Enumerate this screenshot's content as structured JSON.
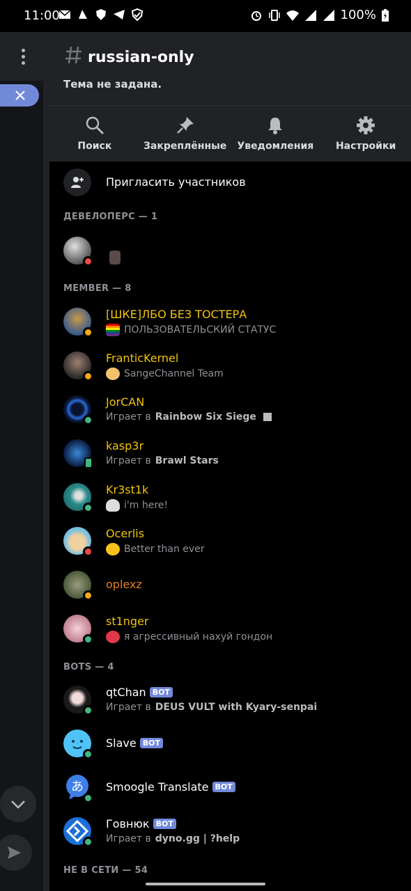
{
  "status_bar": {
    "time": "11:00",
    "battery": "100%"
  },
  "channel": {
    "name": "russian-only",
    "topic": "Тема не задана."
  },
  "actions": [
    {
      "label": "Поиск",
      "icon": "search-icon"
    },
    {
      "label": "Закреплённые",
      "icon": "pin-icon"
    },
    {
      "label": "Уведомления",
      "icon": "bell-icon"
    },
    {
      "label": "Настройки",
      "icon": "gear-icon"
    }
  ],
  "invite_label": "Пригласить участников",
  "sections": {
    "developers": "ДЕВЕЛОПЕРС — 1",
    "member": "MEMBER — 8",
    "bots": "BOTS — 4",
    "offline": "НЕ В СЕТИ — 54"
  },
  "bot_tag": "BOT",
  "members": [
    {
      "name": "[ШКЕ]ЛБО БЕЗ ТОСТЕРА",
      "status": "ПОЛЬЗОВАТЕЛЬСКИЙ СТАТУС"
    },
    {
      "name": "FranticKernel",
      "status": "SangeChannel Team"
    },
    {
      "name": "JorCAN",
      "activity_prefix": "Играет в",
      "activity": "Rainbow Six Siege"
    },
    {
      "name": "kasp3r",
      "activity_prefix": "Играет в",
      "activity": "Brawl Stars"
    },
    {
      "name": "Kr3st1k",
      "status": "i'm here!"
    },
    {
      "name": "Ocerlis",
      "status": "Better than ever"
    },
    {
      "name": "oplexz"
    },
    {
      "name": "st1nger",
      "status": "я агрессивный нахуй гондон"
    }
  ],
  "bots": [
    {
      "name": "qtChan",
      "activity_prefix": "Играет в",
      "activity": "DEUS VULT with Kyary-senpai"
    },
    {
      "name": "Slave"
    },
    {
      "name": "Smoogle Translate"
    },
    {
      "name": "Говнюк",
      "activity_prefix": "Играет в",
      "activity": "dyno.gg | ?help"
    }
  ],
  "colors": {
    "accent": "#7289da",
    "online": "#43b581",
    "idle": "#faa61a",
    "dnd": "#f04747",
    "role_member": "#f1c40f"
  }
}
